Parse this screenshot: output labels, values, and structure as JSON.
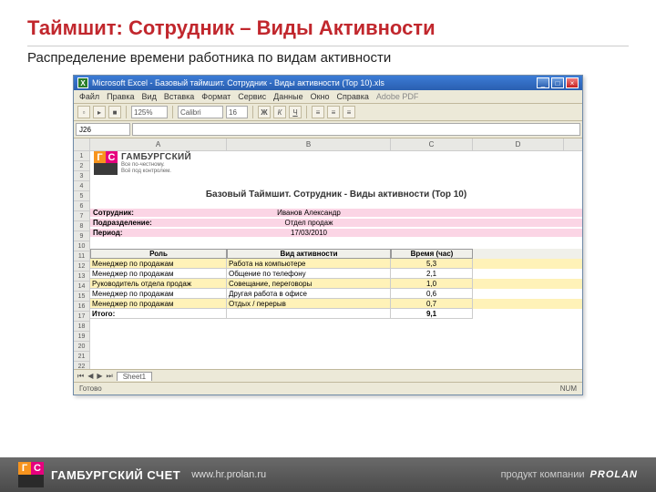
{
  "slide": {
    "title": "Таймшит: Сотрудник – Виды Активности",
    "subtitle": "Распределение времени работника по видам активности"
  },
  "excel": {
    "title": "Microsoft Excel - Базовый таймшит. Сотрудник - Виды активности (Top 10).xls",
    "menu": [
      "Файл",
      "Правка",
      "Вид",
      "Вставка",
      "Формат",
      "Сервис",
      "Данные",
      "Окно",
      "Справка",
      "Adobe PDF"
    ],
    "zoom": "125%",
    "font": "Calibri",
    "fontsize": "16",
    "namebox": "J26",
    "cols": [
      "A",
      "B",
      "C",
      "D"
    ],
    "sheet_tab": "Sheet1",
    "status_left": "Готово",
    "status_right": "NUM"
  },
  "logo": {
    "g": "Г",
    "c": "С",
    "brand": "ГАМБУРГСКИЙ",
    "line1": "Все по-честному.",
    "line2": "Всё под контролем."
  },
  "report": {
    "title": "Базовый Таймшит. Сотрудник - Виды активности (Top 10)",
    "employee_label": "Сотрудник:",
    "employee_value": "Иванов Александр",
    "dept_label": "Подразделение:",
    "dept_value": "Отдел продаж",
    "period_label": "Период:",
    "period_value": "17/03/2010",
    "hdr_role": "Роль",
    "hdr_activity": "Вид активности",
    "hdr_time": "Время (час)",
    "total_label": "Итого:",
    "total_value": "9,1",
    "rows": [
      {
        "role": "Менеджер по продажам",
        "activity": "Работа на компьютере",
        "time": "5,3"
      },
      {
        "role": "Менеджер по продажам",
        "activity": "Общение по телефону",
        "time": "2,1"
      },
      {
        "role": "Руководитель отдела продаж",
        "activity": "Совещание, переговоры",
        "time": "1,0"
      },
      {
        "role": "Менеджер по продажам",
        "activity": "Другая работа в офисе",
        "time": "0,6"
      },
      {
        "role": "Менеджер по продажам",
        "activity": "Отдых / перерыв",
        "time": "0,7"
      }
    ]
  },
  "footer": {
    "brand": "ГАМБУРГСКИЙ СЧЕТ",
    "url": "www.hr.prolan.ru",
    "product_of": "продукт компании",
    "company": "PROLAN"
  }
}
